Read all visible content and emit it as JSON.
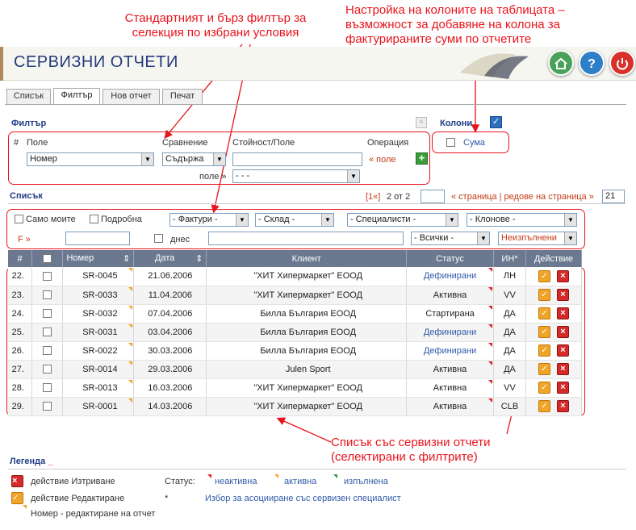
{
  "annotations": {
    "filter": "Стандартният и бърз филтър за селекция по избрани условия",
    "filter_l1": "Стандартният и бърз филтър за",
    "filter_l2": "селекция по избрани условия",
    "columns_l1": "Настройка на колоните на таблицата –",
    "columns_l2": "възможност за добавяне на колона за",
    "columns_l3": "фактурираните суми по отчетите",
    "list_l1": "Списък със сервизни отчети",
    "list_l2": "(селектирани с филтрите)"
  },
  "header": {
    "title": "СЕРВИЗНИ ОТЧЕТИ",
    "home_icon": "home-icon",
    "help_icon": "help-icon",
    "power_icon": "power-icon"
  },
  "tabs": [
    "Списък",
    "Филтър",
    "Нов отчет",
    "Печат"
  ],
  "filter": {
    "title": "Филтър",
    "hash": "#",
    "field_label": "Поле",
    "compare_label": "Сравнение",
    "value_label": "Стойност/Поле",
    "operation_label": "Операция",
    "field_value": "Номер",
    "compare_value": "Съдържа",
    "value": "",
    "op_link": "« поле",
    "field2_label": "поле »",
    "field2_value": "- - -"
  },
  "columns": {
    "title": "Колони",
    "sum_label": "Сума"
  },
  "list": {
    "title": "Списък",
    "pager_first": "[1«]",
    "pager_text": "2 от 2",
    "page_link": "« страница | редове на страница »",
    "rows_per_page": "21"
  },
  "quickfilter": {
    "only_mine": "Само моите",
    "detailed": "Подробна",
    "invoices": "- Фактури -",
    "warehouse": "- Склад -",
    "specialists": "- Специалисти -",
    "branches": "- Клонове -",
    "f_link": "F »",
    "today": "днес",
    "all": "- Всички -",
    "unfinished": "Неизпълнени"
  },
  "table": {
    "headers": [
      "#",
      "",
      "Номер",
      "Дата",
      "Клиент",
      "Статус",
      "ИН*",
      "Действие"
    ],
    "rows": [
      {
        "n": "22.",
        "num": "SR-0045",
        "date": "21.06.2006",
        "client": "\"ХИТ Хипермаркет\" ЕООД",
        "status": "Дефинирани",
        "in": "ЛН"
      },
      {
        "n": "23.",
        "num": "SR-0033",
        "date": "11.04.2006",
        "client": "\"ХИТ Хипермаркет\" ЕООД",
        "status": "Активна",
        "in": "VV"
      },
      {
        "n": "24.",
        "num": "SR-0032",
        "date": "07.04.2006",
        "client": "Билла България ЕООД",
        "status": "Стартирана",
        "in": "ДА"
      },
      {
        "n": "25.",
        "num": "SR-0031",
        "date": "03.04.2006",
        "client": "Билла България ЕООД",
        "status": "Дефинирани",
        "in": "ДА"
      },
      {
        "n": "26.",
        "num": "SR-0022",
        "date": "30.03.2006",
        "client": "Билла България ЕООД",
        "status": "Дефинирани",
        "in": "ДА"
      },
      {
        "n": "27.",
        "num": "SR-0014",
        "date": "29.03.2006",
        "client": "Julen Sport",
        "status": "Активна",
        "in": "ДА"
      },
      {
        "n": "28.",
        "num": "SR-0013",
        "date": "16.03.2006",
        "client": "\"ХИТ Хипермаркет\" ЕООД",
        "status": "Активна",
        "in": "VV"
      },
      {
        "n": "29.",
        "num": "SR-0001",
        "date": "14.03.2006",
        "client": "\"ХИТ Хипермаркет\" ЕООД",
        "status": "Активна",
        "in": "CLB"
      }
    ]
  },
  "legend": {
    "title": "Легенда",
    "delete": "действие Изтриване",
    "edit": "действие Редактиране",
    "number_edit": "Номер - редактиране на отчет",
    "status_label": "Статус:",
    "inactive": "неактивна",
    "active": "активна",
    "done": "изпълнена",
    "star": "*",
    "star_text": "Избор за асоцииране със сервизен специалист"
  },
  "colors": {
    "annotation": "#e8141b",
    "title": "#243a7c",
    "table_header": "#6b7890",
    "edit": "#f0a428",
    "delete": "#d42a2a"
  }
}
